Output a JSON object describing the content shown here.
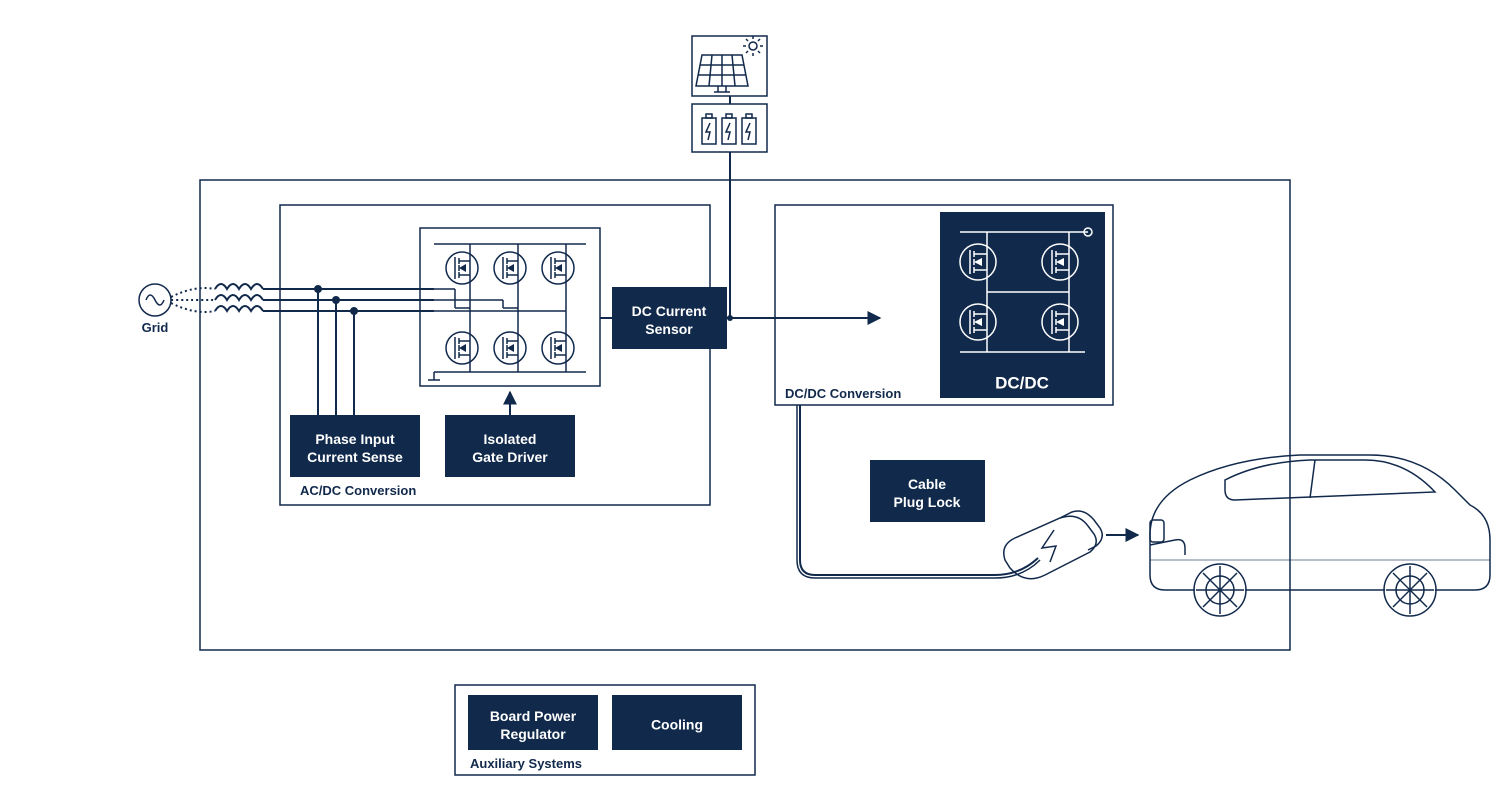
{
  "grid_label": "Grid",
  "blocks": {
    "phase_input": {
      "line1": "Phase Input",
      "line2": "Current Sense"
    },
    "gate_driver": {
      "line1": "Isolated",
      "line2": "Gate Driver"
    },
    "dc_sensor": {
      "line1": "DC Current",
      "line2": "Sensor"
    },
    "cable_lock": {
      "line1": "Cable",
      "line2": "Plug Lock"
    },
    "board_power": {
      "line1": "Board Power",
      "line2": "Regulator"
    },
    "cooling": {
      "line1": "Cooling"
    },
    "dcdc": {
      "line1": "DC/DC"
    }
  },
  "sections": {
    "acdc": "AC/DC Conversion",
    "dcdc": "DC/DC Conversion",
    "aux": "Auxiliary Systems"
  }
}
